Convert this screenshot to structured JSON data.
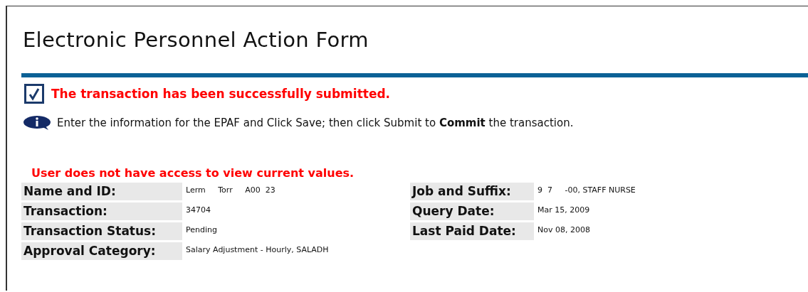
{
  "title": "Electronic Personnel Action Form",
  "confirmation": "The transaction has been successfully submitted.",
  "info": "Enter the information for the EPAF and Click Save; then click Submit to **Commit** the transaction.",
  "warning": "User does not have access to view current values.",
  "fields_left": [
    {
      "label": "Name and ID:",
      "value": "Lerm     Torr     A00  23"
    },
    {
      "label": "Transaction:",
      "value": "34704"
    },
    {
      "label": "Transaction Status:",
      "value": "Pending"
    },
    {
      "label": "Approval Category:",
      "value": "Salary Adjustment - Hourly, SALADH"
    }
  ],
  "fields_right": [
    {
      "label": "Job and Suffix:",
      "value": "9  7     -00, STAFF NURSE"
    },
    {
      "label": "Query Date:",
      "value": "Mar 15, 2009"
    },
    {
      "label": "Last Paid Date:",
      "value": "Nov 08, 2008"
    }
  ]
}
